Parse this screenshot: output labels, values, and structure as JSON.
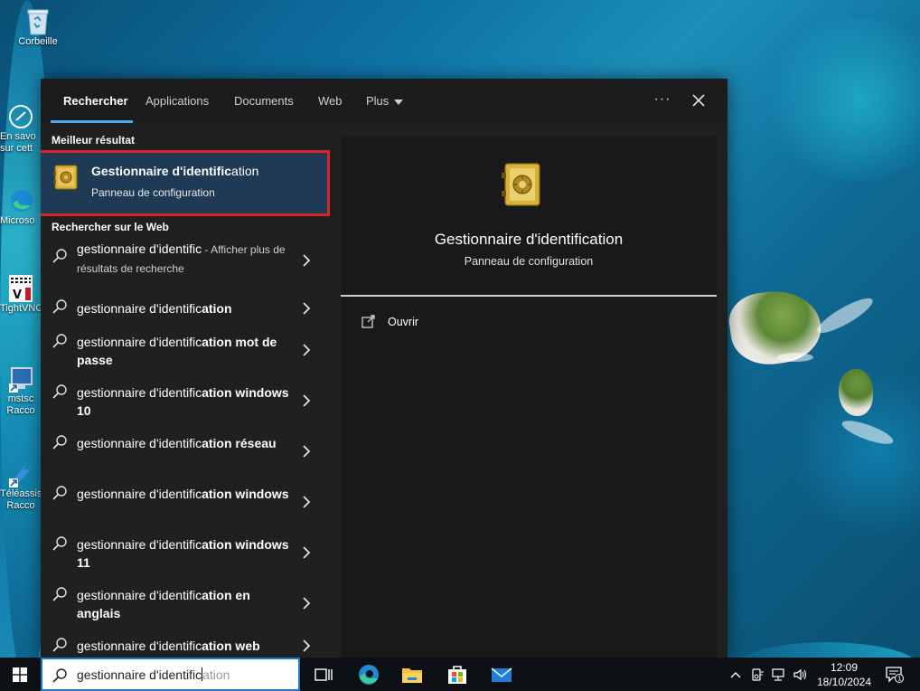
{
  "desktop": {
    "icons": [
      {
        "label": "Corbeille"
      },
      {
        "label_line1": "En savo",
        "label_line2": "sur cett"
      },
      {
        "label": "Microso"
      },
      {
        "label": "TightVNC"
      },
      {
        "label_line1": "mstsc",
        "label_line2": "Racco"
      },
      {
        "label_line1": "Téléassis",
        "label_line2": "Racco"
      }
    ]
  },
  "search_panel": {
    "tabs": [
      {
        "label": "Rechercher",
        "active": true
      },
      {
        "label": "Applications"
      },
      {
        "label": "Documents"
      },
      {
        "label": "Web"
      },
      {
        "label": "Plus"
      }
    ],
    "more_options_icon": "ellipsis-icon",
    "close_icon": "close-icon",
    "best_match_heading": "Meilleur résultat",
    "best_match": {
      "title_match": "Gestionnaire d'identific",
      "title_rest": "ation",
      "subtitle": "Panneau de configuration",
      "icon": "credential-manager-icon"
    },
    "web_heading": "Rechercher sur le Web",
    "web_results": [
      {
        "query": "gestionnaire d'identific",
        "rest_bold": "",
        "suffix": " - Afficher plus de résultats de recherche"
      },
      {
        "query": "gestionnaire d'identific",
        "rest": "ation",
        "rest_bold": ""
      },
      {
        "query": "gestionnaire d'identific",
        "rest": "ation",
        "rest_bold": " mot de passe"
      },
      {
        "query": "gestionnaire d'identific",
        "rest": "ation",
        "rest_bold": " windows 10"
      },
      {
        "query": "gestionnaire d'identific",
        "rest": "ation",
        "rest_bold": " réseau"
      },
      {
        "query": "gestionnaire d'identific",
        "rest": "ation",
        "rest_bold": " windows"
      },
      {
        "query": "gestionnaire d'identific",
        "rest": "ation",
        "rest_bold": " windows 11"
      },
      {
        "query": "gestionnaire d'identific",
        "rest": "ation",
        "rest_bold": " en anglais"
      },
      {
        "query": "gestionnaire d'identific",
        "rest": "ation",
        "rest_bold": " web"
      }
    ],
    "preview": {
      "title": "Gestionnaire d'identification",
      "subtitle": "Panneau de configuration",
      "actions": [
        {
          "label": "Ouvrir",
          "icon": "open-icon"
        }
      ]
    }
  },
  "taskbar": {
    "search_typed": "gestionnaire d'identific",
    "search_ghost": "ation",
    "apps": [
      "task-view-icon",
      "edge-icon",
      "file-explorer-icon",
      "store-icon",
      "mail-icon"
    ],
    "time": "12:09",
    "date": "18/10/2024",
    "notification_count": "1"
  },
  "colors": {
    "accent": "#4ca7e6",
    "highlight_border": "#d9232d",
    "selected_bg": "#1e3a55"
  }
}
